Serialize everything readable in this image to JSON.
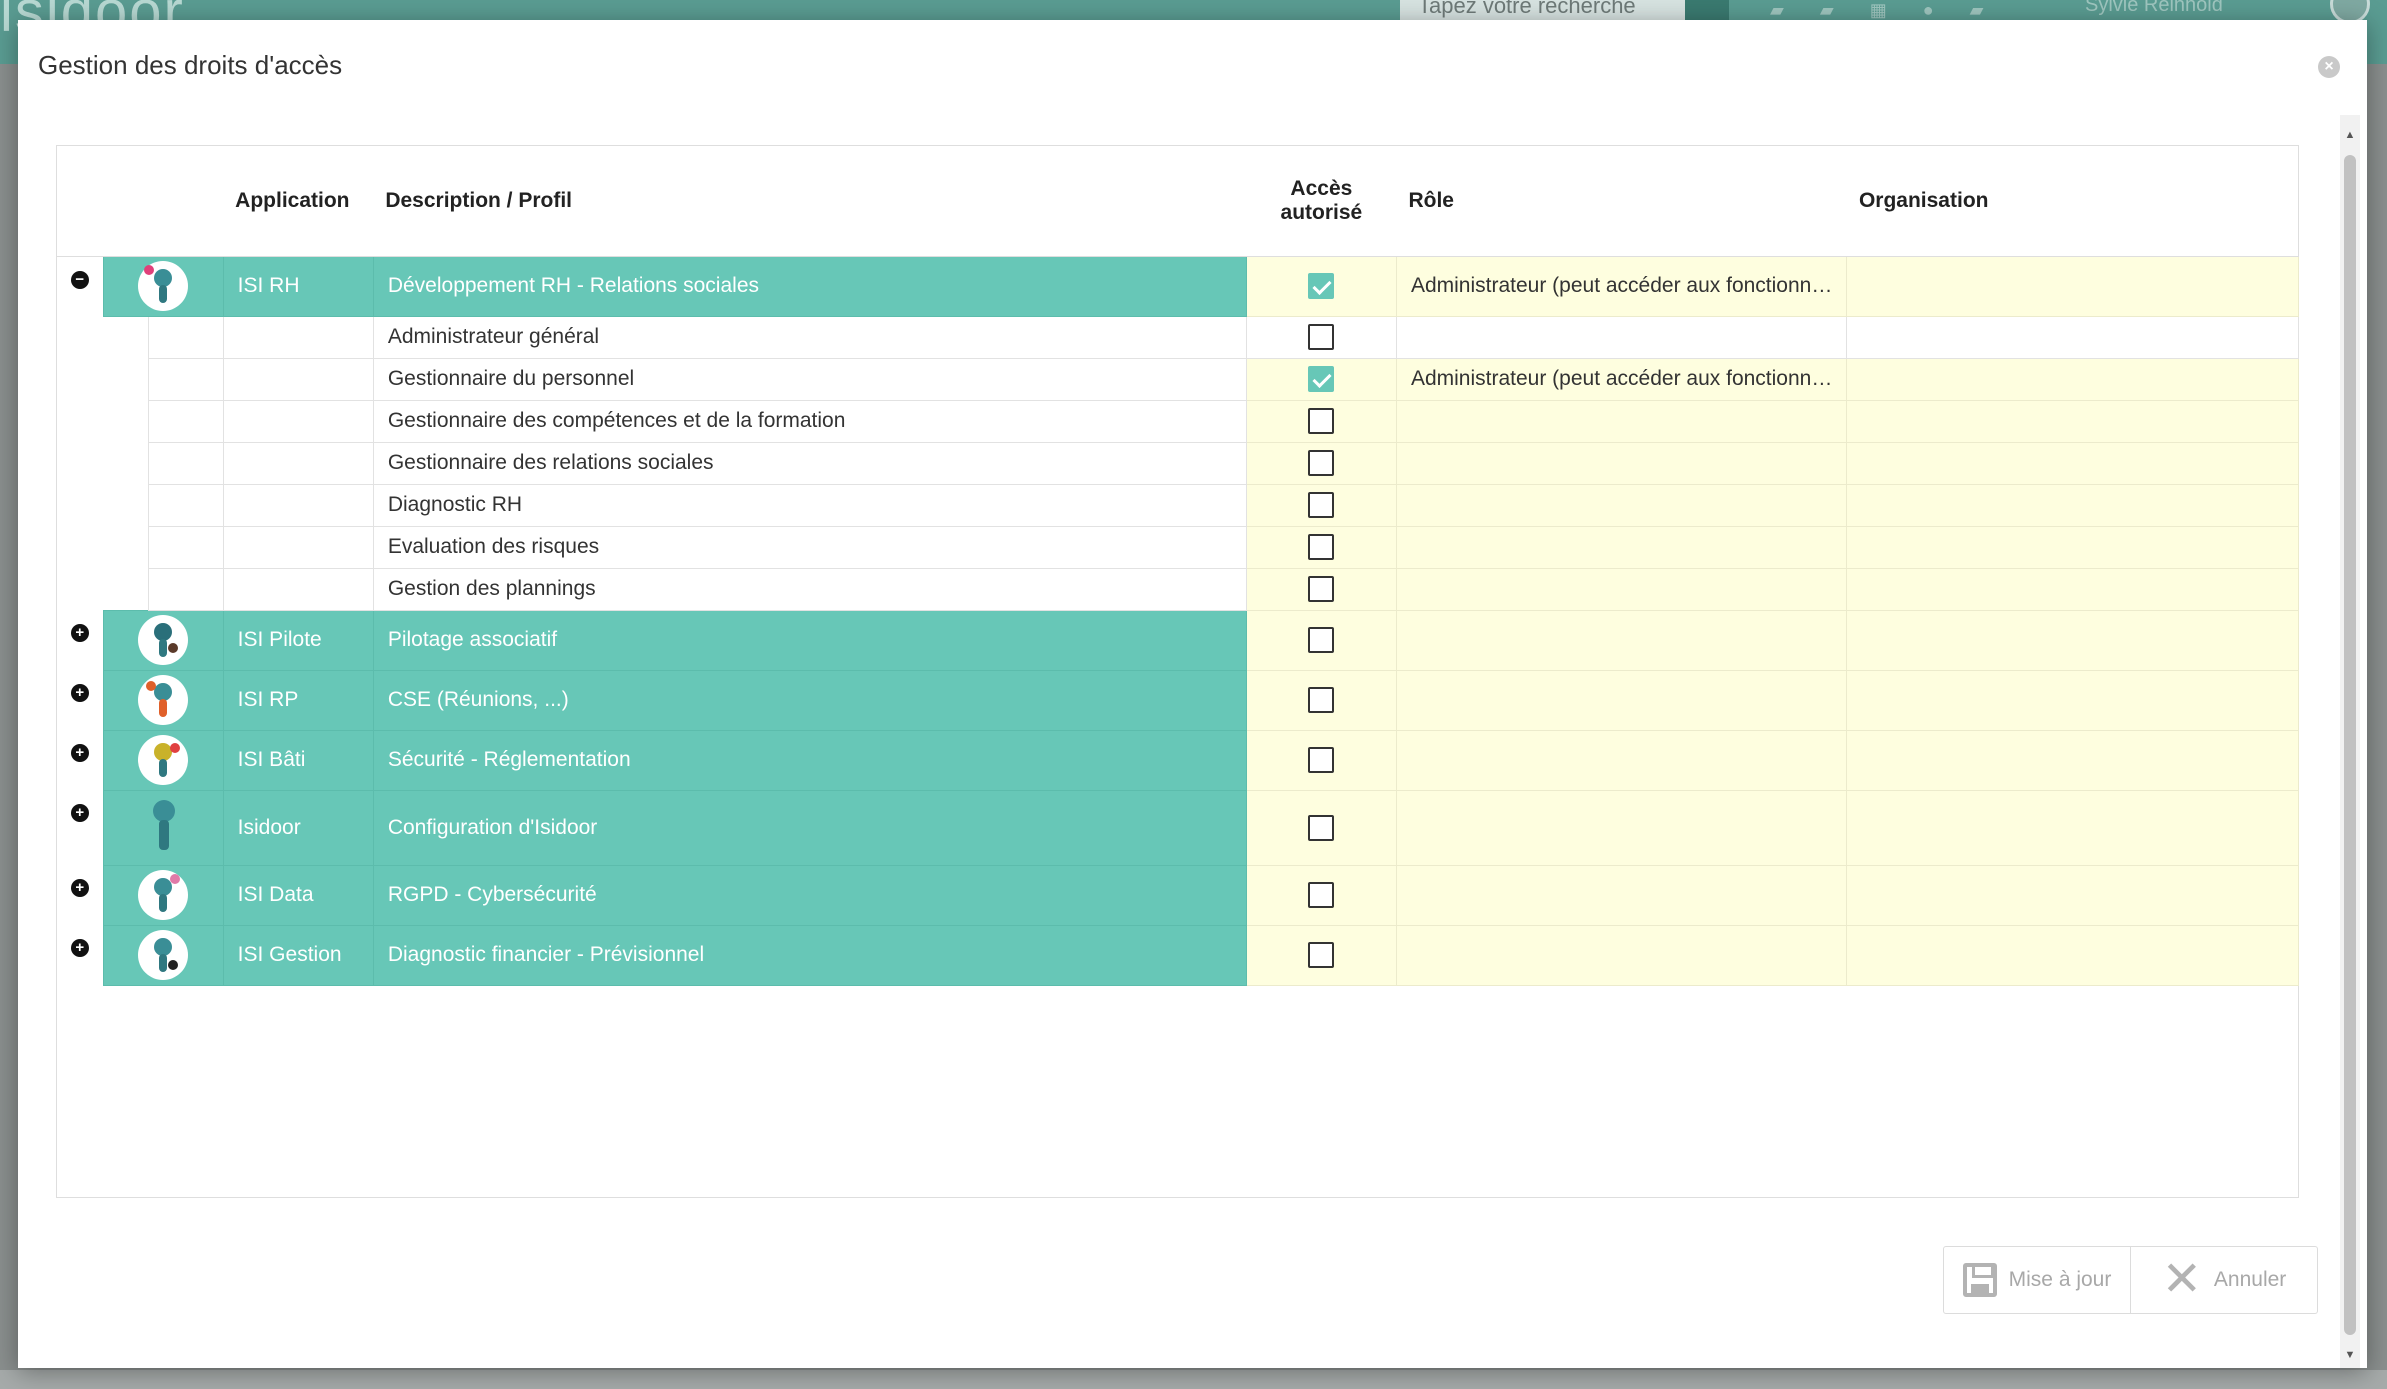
{
  "background": {
    "logo": "isidoor",
    "search_placeholder": "Tapez votre recherche",
    "user_name": "Sylvie Reinhold"
  },
  "modal": {
    "title": "Gestion des droits d'accès",
    "close_label": "×"
  },
  "columns": {
    "application": "Application",
    "description": "Description / Profil",
    "access": "Accès autorisé",
    "role": "Rôle",
    "organisation": "Organisation"
  },
  "applications": [
    {
      "name": "ISI RH",
      "description": "Développement RH - Relations sociales",
      "expanded": true,
      "toggle": "−",
      "access": true,
      "role": "Administrateur (peut accéder aux fonctionnalités d'administration)",
      "organisation": "",
      "icon": "robot-rh-icon",
      "profiles": [
        {
          "name": "Administrateur général",
          "access": false,
          "role": ""
        },
        {
          "name": "Gestionnaire du personnel",
          "access": true,
          "role": "Administrateur (peut accéder aux fonctionnalités d'administration)"
        },
        {
          "name": "Gestionnaire des compétences et de la formation",
          "access": false,
          "role": ""
        },
        {
          "name": "Gestionnaire des relations sociales",
          "access": false,
          "role": ""
        },
        {
          "name": "Diagnostic RH",
          "access": false,
          "role": ""
        },
        {
          "name": "Evaluation des risques",
          "access": false,
          "role": ""
        },
        {
          "name": "Gestion des plannings",
          "access": false,
          "role": ""
        }
      ]
    },
    {
      "name": "ISI Pilote",
      "description": "Pilotage associatif",
      "toggle": "+",
      "access": false,
      "role": "",
      "organisation": "",
      "icon": "robot-pilote-icon"
    },
    {
      "name": "ISI RP",
      "description": "CSE (Réunions, ...)",
      "toggle": "+",
      "access": false,
      "role": "",
      "organisation": "",
      "icon": "robot-rp-icon"
    },
    {
      "name": "ISI Bâti",
      "description": "Sécurité - Réglementation",
      "toggle": "+",
      "access": false,
      "role": "",
      "organisation": "",
      "icon": "robot-bati-icon"
    },
    {
      "name": "Isidoor",
      "description": "Configuration d'Isidoor",
      "toggle": "+",
      "access": false,
      "role": "",
      "organisation": "",
      "icon": "robot-isidoor-icon"
    },
    {
      "name": "ISI Data",
      "description": "RGPD - Cybersécurité",
      "toggle": "+",
      "access": false,
      "role": "",
      "organisation": "",
      "icon": "robot-data-icon"
    },
    {
      "name": "ISI Gestion",
      "description": "Diagnostic financier - Prévisionnel",
      "toggle": "+",
      "access": false,
      "role": "",
      "organisation": "",
      "icon": "robot-gestion-icon"
    }
  ],
  "buttons": {
    "update": "Mise à jour",
    "cancel": "Annuler"
  },
  "colors": {
    "teal": "#67c7b7",
    "yellow": "#fefedf",
    "header_bg": "#5a9c92"
  }
}
